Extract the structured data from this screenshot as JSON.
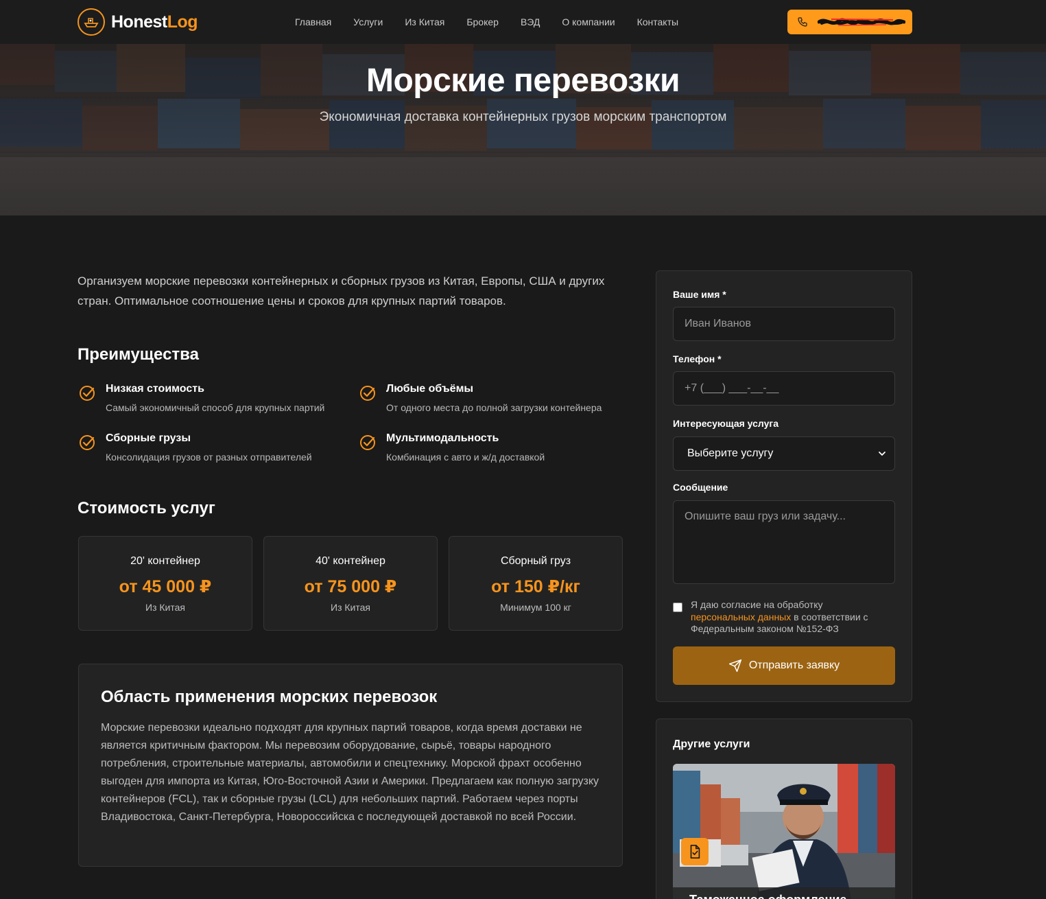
{
  "header": {
    "brand_part1": "Honest",
    "brand_part2": "Log",
    "nav": [
      "Главная",
      "Услуги",
      "Из Китая",
      "Брокер",
      "ВЭД",
      "О компании",
      "Контакты"
    ],
    "accent_color": "#f7941d"
  },
  "hero": {
    "title": "Морские перевозки",
    "subtitle": "Экономичная доставка контейнерных грузов морским транспортом"
  },
  "intro": "Организуем морские перевозки контейнерных и сборных грузов из Китая, Европы, США и других стран. Оптимальное соотношение цены и сроков для крупных партий товаров.",
  "advantages": {
    "title": "Преимущества",
    "items": [
      {
        "title": "Низкая стоимость",
        "desc": "Самый экономичный способ для крупных партий"
      },
      {
        "title": "Любые объёмы",
        "desc": "От одного места до полной загрузки контейнера"
      },
      {
        "title": "Сборные грузы",
        "desc": "Консолидация грузов от разных отправителей"
      },
      {
        "title": "Мультимодальность",
        "desc": "Комбинация с авто и ж/д доставкой"
      }
    ]
  },
  "pricing": {
    "title": "Стоимость услуг",
    "items": [
      {
        "name": "20' контейнер",
        "price": "от 45 000 ₽",
        "note": "Из Китая"
      },
      {
        "name": "40' контейнер",
        "price": "от 75 000 ₽",
        "note": "Из Китая"
      },
      {
        "name": "Сборный груз",
        "price": "от 150 ₽/кг",
        "note": "Минимум 100 кг"
      }
    ]
  },
  "scope": {
    "title": "Область применения морских перевозок",
    "text": "Морские перевозки идеально подходят для крупных партий товаров, когда время доставки не является критичным фактором. Мы перевозим оборудование, сырьё, товары народного потребления, строительные материалы, автомобили и спецтехнику. Морской фрахт особенно выгоден для импорта из Китая, Юго-Восточной Азии и Америки. Предлагаем как полную загрузку контейнеров (FCL), так и сборные грузы (LCL) для небольших партий. Работаем через порты Владивостока, Санкт-Петербурга, Новороссийска с последующей доставкой по всей России."
  },
  "form": {
    "name_label": "Ваше имя *",
    "name_placeholder": "Иван Иванов",
    "phone_label": "Телефон *",
    "phone_placeholder": "+7 (___) ___-__-__",
    "service_label": "Интересующая услуга",
    "service_value": "Выберите услугу",
    "message_label": "Сообщение",
    "message_placeholder": "Опишите ваш груз или задачу...",
    "consent_pre": "Я даю согласие на обработку ",
    "consent_link": "персональных данных",
    "consent_post": " в соответствии с Федеральным законом №152-ФЗ",
    "submit_label": "Отправить заявку"
  },
  "other_services": {
    "title": "Другие услуги",
    "card_title": "Таможенное оформление"
  }
}
